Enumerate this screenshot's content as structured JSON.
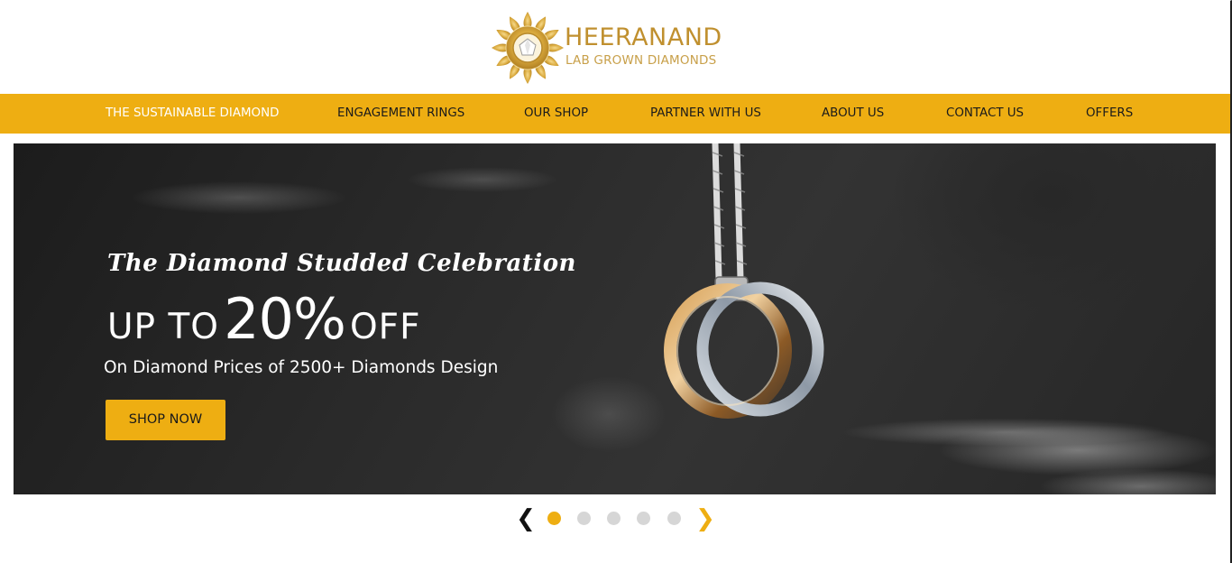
{
  "brand": {
    "name": "HEERANAND",
    "tagline": "LAB GROWN DIAMONDS",
    "logo_icon": "diamond-mandala-icon"
  },
  "nav": {
    "items": [
      {
        "label": "THE SUSTAINABLE DIAMOND",
        "active": true
      },
      {
        "label": "ENGAGEMENT RINGS",
        "active": false
      },
      {
        "label": "OUR SHOP",
        "active": false
      },
      {
        "label": "PARTNER WITH US",
        "active": false
      },
      {
        "label": "ABOUT US",
        "active": false
      },
      {
        "label": "CONTACT US",
        "active": false
      },
      {
        "label": "OFFERS",
        "active": false
      }
    ]
  },
  "hero": {
    "tagline": "The Diamond Studded Celebration",
    "offer_prefix": "UP TO",
    "offer_value": "20%",
    "offer_suffix": "OFF",
    "subline": "On Diamond Prices of 2500+ Diamonds Design",
    "cta_label": "SHOP NOW"
  },
  "carousel": {
    "prev_icon": "chevron-left-icon",
    "next_icon": "chevron-right-icon",
    "prev_glyph": "❮",
    "next_glyph": "❯",
    "slide_count": 5,
    "active_index": 0
  },
  "colors": {
    "accent": "#eeae12",
    "brand_gold": "#c0902f",
    "hero_bg": "#262626",
    "dot_inactive": "#d6d6d6"
  }
}
